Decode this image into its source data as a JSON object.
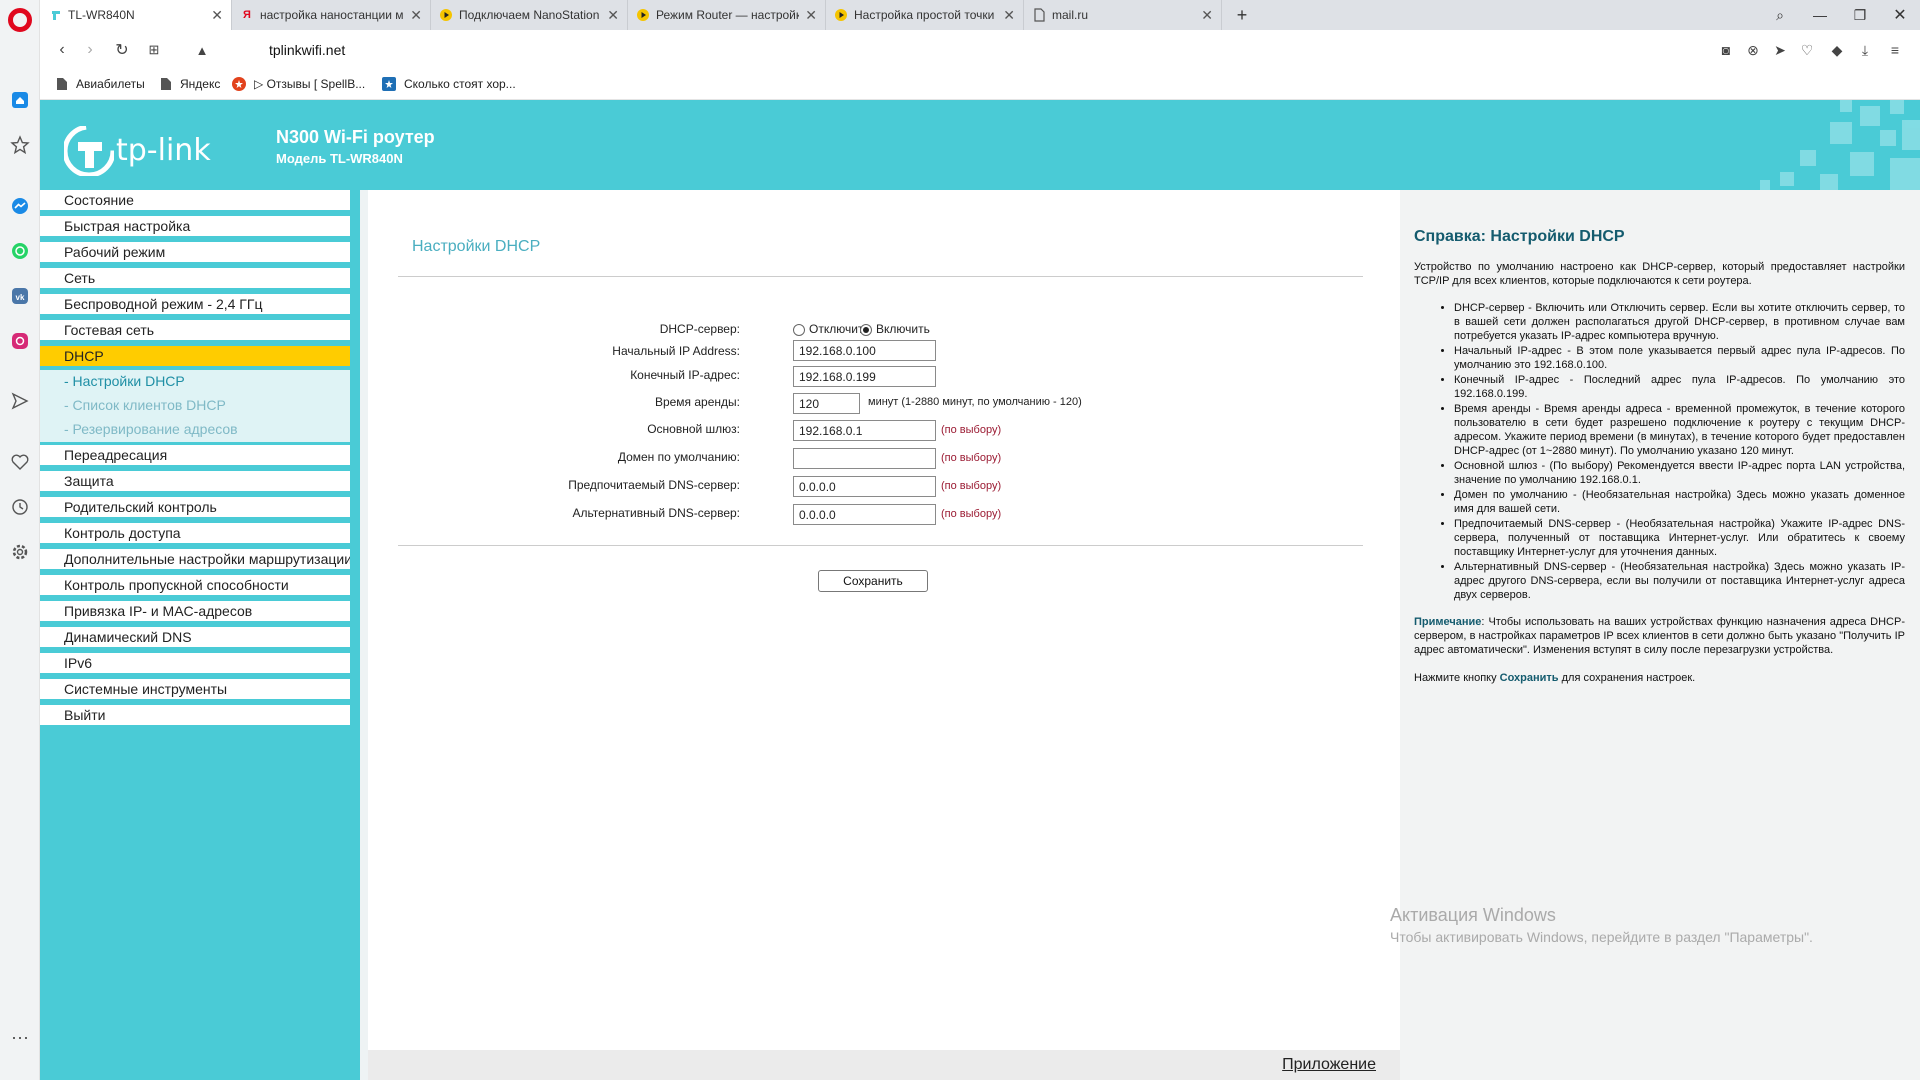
{
  "tabs": [
    {
      "title": "TL-WR840N",
      "icon": "tp-link-icon",
      "active": true
    },
    {
      "title": "настройка наностанции м",
      "icon": "yandex-icon"
    },
    {
      "title": "Подключаем NanoStation",
      "icon": "play-icon"
    },
    {
      "title": "Режим Router — настройк",
      "icon": "play-icon"
    },
    {
      "title": "Настройка простой точки",
      "icon": "play-icon"
    },
    {
      "title": "mail.ru",
      "icon": "page-icon"
    }
  ],
  "address": {
    "url": "tplinkwifi.net"
  },
  "bookmarks": [
    {
      "label": "Авиабилеты"
    },
    {
      "label": "Яндекс"
    },
    {
      "label": "▷ Отзывы [ SpellB..."
    },
    {
      "label": "Сколько стоят хор..."
    }
  ],
  "banner": {
    "logo": "tp-link",
    "title": "N300 Wi-Fi роутер",
    "model": "Модель TL-WR840N"
  },
  "menu": {
    "items": [
      "Состояние",
      "Быстрая настройка",
      "Рабочий режим",
      "Сеть",
      "Беспроводной режим - 2,4 ГГц",
      "Гостевая сеть",
      "DHCP",
      "Переадресация",
      "Защита",
      "Родительский контроль",
      "Контроль доступа",
      "Дополнительные настройки маршрутизации",
      "Контроль пропускной способности",
      "Привязка IP- и MAC-адресов",
      "Динамический DNS",
      "IPv6",
      "Системные инструменты",
      "Выйти"
    ],
    "sub": [
      "- Настройки DHCP",
      "- Список клиентов DHCP",
      "- Резервирование адресов"
    ]
  },
  "form": {
    "title": "Настройки DHCP",
    "dhcp_server_label": "DHCP-сервер:",
    "disable_label": "Отключить",
    "enable_label": "Включить",
    "start_ip_label": "Начальный IP Address:",
    "start_ip": "192.168.0.100",
    "end_ip_label": "Конечный IP-адрес:",
    "end_ip": "192.168.0.199",
    "lease_label": "Время аренды:",
    "lease": "120",
    "lease_hint": "минут (1-2880 минут, по умолчанию - 120)",
    "gateway_label": "Основной шлюз:",
    "gateway": "192.168.0.1",
    "domain_label": "Домен по умолчанию:",
    "domain": "",
    "dns1_label": "Предпочитаемый DNS-сервер:",
    "dns1": "0.0.0.0",
    "dns2_label": "Альтернативный DNS-сервер:",
    "dns2": "0.0.0.0",
    "optional": "(по выбору)",
    "save": "Сохранить",
    "app_link": "Приложение"
  },
  "help": {
    "title": "Справка: Настройки DHCP",
    "intro": "Устройство по умолчанию настроено как DHCP-сервер, который предоставляет настройки TCP/IP для всех клиентов, которые подключаются к сети роутера.",
    "bullets": [
      "DHCP-сервер - Включить или Отключить сервер. Если вы хотите отключить сервер, то в вашей сети должен располагаться другой DHCP-сервер, в противном случае вам потребуется указать IP-адрес компьютера вручную.",
      "Начальный IP-адрес - В этом поле указывается первый адрес пула IP-адресов. По умолчанию это 192.168.0.100.",
      "Конечный IP-адрес - Последний адрес пула IP-адресов. По умолчанию это 192.168.0.199.",
      "Время аренды - Время аренды адреса - временной промежуток, в течение которого пользователю в сети будет разрешено подключение к роутеру с текущим DHCP-адресом. Укажите период времени (в минутах), в течение которого будет предоставлен DHCP-адрес (от 1~2880 минут). По умолчанию указано 120 минут.",
      "Основной шлюз - (По выбору) Рекомендуется ввести IP-адрес порта LAN устройства, значение по умолчанию 192.168.0.1.",
      "Домен по умолчанию - (Необязательная настройка) Здесь можно указать доменное имя для вашей сети.",
      "Предпочитаемый DNS-сервер - (Необязательная настройка) Укажите IP-адрес DNS-сервера, полученный от поставщика Интернет-услуг. Или обратитесь к своему поставщику Интернет-услуг для уточнения данных.",
      "Альтернативный DNS-сервер - (Необязательная настройка) Здесь можно указать IP-адрес другого DNS-сервера, если вы получили от поставщика Интернет-услуг адреса двух серверов."
    ],
    "note_label": "Примечание",
    "note": ": Чтобы использовать на ваших устройствах функцию назначения адреса DHCP-сервером, в настройках параметров IP всех клиентов в сети должно быть указано \"Получить IP адрес автоматически\". Изменения вступят в силу после перезагрузки устройства.",
    "save_pre": "Нажмите кнопку ",
    "save_word": "Сохранить",
    "save_post": " для сохранения настроек."
  },
  "watermark": {
    "line1": "Активация Windows",
    "line2": "Чтобы активировать Windows, перейдите в раздел \"Параметры\"."
  },
  "colors": {
    "brand": "#4acbd6",
    "active_menu": "#ffcc00",
    "optional": "#9b1b33"
  }
}
